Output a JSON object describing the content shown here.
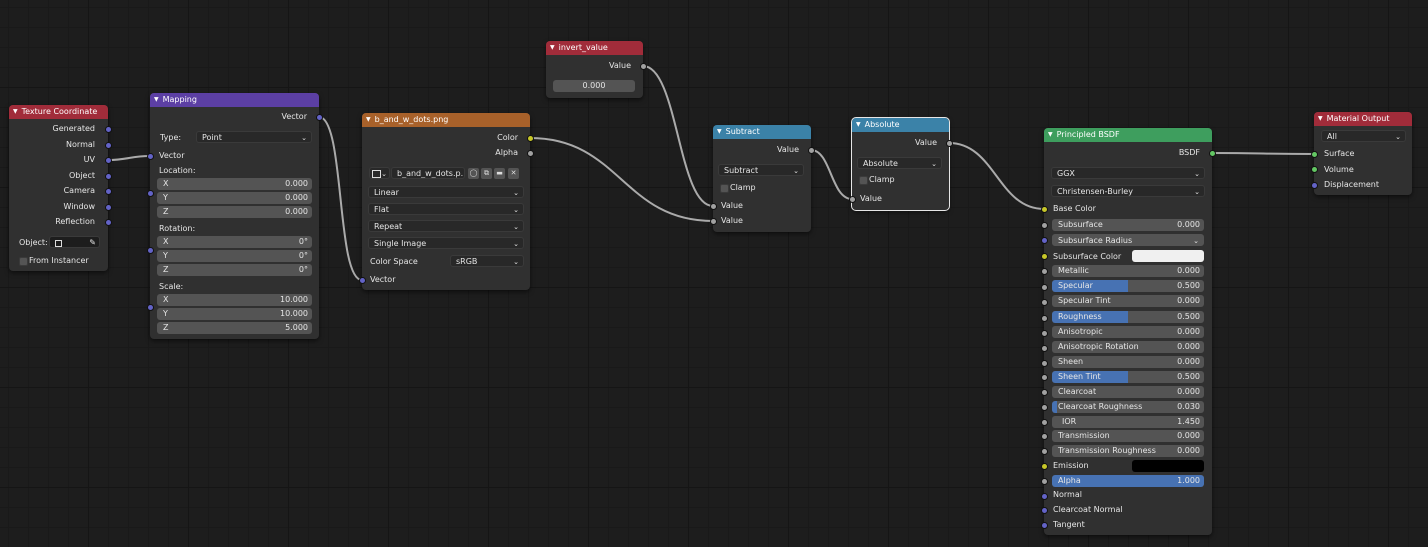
{
  "colors": {
    "bg": "#1d1d1d",
    "node": "#303030",
    "hdr_input": "#a12c3a",
    "hdr_vector": "#5c3fa4",
    "hdr_texture": "#a8612a",
    "hdr_converter": "#3b82a8",
    "hdr_shader": "#3e9e5e",
    "socket_vector": "#6363c7",
    "socket_value": "#a1a1a1",
    "socket_color": "#c7c729",
    "socket_shader": "#63c763",
    "slider_fill": "#4772b3"
  },
  "tex_coord": {
    "title": "Texture Coordinate",
    "outputs": [
      "Generated",
      "Normal",
      "UV",
      "Object",
      "Camera",
      "Window",
      "Reflection"
    ],
    "object_label": "Object:",
    "from_instancer": "From Instancer",
    "icons": {
      "object": "object-icon",
      "eyedropper": "eyedropper-icon"
    }
  },
  "mapping": {
    "title": "Mapping",
    "output": "Vector",
    "type_label": "Type:",
    "type_value": "Point",
    "vector_in": "Vector",
    "location_label": "Location:",
    "location": [
      {
        "axis": "X",
        "value": "0.000"
      },
      {
        "axis": "Y",
        "value": "0.000"
      },
      {
        "axis": "Z",
        "value": "0.000"
      }
    ],
    "rotation_label": "Rotation:",
    "rotation": [
      {
        "axis": "X",
        "value": "0°"
      },
      {
        "axis": "Y",
        "value": "0°"
      },
      {
        "axis": "Z",
        "value": "0°"
      }
    ],
    "scale_label": "Scale:",
    "scale": [
      {
        "axis": "X",
        "value": "10.000"
      },
      {
        "axis": "Y",
        "value": "10.000"
      },
      {
        "axis": "Z",
        "value": "5.000"
      }
    ]
  },
  "image_tex": {
    "title": "b_and_w_dots.png",
    "out_color": "Color",
    "out_alpha": "Alpha",
    "image_name": "b_and_w_dots.p...",
    "interpolation": "Linear",
    "projection": "Flat",
    "extension": "Repeat",
    "source": "Single Image",
    "colorspace_label": "Color Space",
    "colorspace_value": "sRGB",
    "vector_in": "Vector",
    "icons": {
      "image": "image-icon",
      "fake_user": "shield-icon",
      "duplicate": "duplicate-icon",
      "open": "folder-icon",
      "unlink": "close-icon"
    }
  },
  "invert": {
    "title": "invert_value",
    "output": "Value",
    "value": "0.000"
  },
  "subtract": {
    "title": "Subtract",
    "output": "Value",
    "operation": "Subtract",
    "clamp": "Clamp",
    "in1": "Value",
    "in2": "Value"
  },
  "absolute": {
    "title": "Absolute",
    "output": "Value",
    "operation": "Absolute",
    "clamp": "Clamp",
    "in1": "Value"
  },
  "bsdf": {
    "title": "Principled BSDF",
    "output": "BSDF",
    "distribution": "GGX",
    "subsurface_method": "Christensen-Burley",
    "base_color": "Base Color",
    "subsurface": {
      "label": "Subsurface",
      "value": "0.000",
      "fill": 0
    },
    "subsurface_radius": "Subsurface Radius",
    "subsurface_color": "Subsurface Color",
    "metallic": {
      "label": "Metallic",
      "value": "0.000",
      "fill": 0
    },
    "specular": {
      "label": "Specular",
      "value": "0.500",
      "fill": 0.5
    },
    "specular_tint": {
      "label": "Specular Tint",
      "value": "0.000",
      "fill": 0
    },
    "roughness": {
      "label": "Roughness",
      "value": "0.500",
      "fill": 0.5
    },
    "anisotropic": {
      "label": "Anisotropic",
      "value": "0.000",
      "fill": 0
    },
    "anisotropic_rotation": {
      "label": "Anisotropic Rotation",
      "value": "0.000",
      "fill": 0
    },
    "sheen": {
      "label": "Sheen",
      "value": "0.000",
      "fill": 0
    },
    "sheen_tint": {
      "label": "Sheen Tint",
      "value": "0.500",
      "fill": 0.5
    },
    "clearcoat": {
      "label": "Clearcoat",
      "value": "0.000",
      "fill": 0
    },
    "clearcoat_roughness": {
      "label": "Clearcoat Roughness",
      "value": "0.030",
      "fill": 0.03
    },
    "ior": {
      "label": "IOR",
      "value": "1.450"
    },
    "transmission": {
      "label": "Transmission",
      "value": "0.000",
      "fill": 0
    },
    "transmission_roughness": {
      "label": "Transmission Roughness",
      "value": "0.000",
      "fill": 0
    },
    "emission": "Emission",
    "alpha": {
      "label": "Alpha",
      "value": "1.000",
      "fill": 1
    },
    "normal": "Normal",
    "clearcoat_normal": "Clearcoat Normal",
    "tangent": "Tangent",
    "subsurface_color_swatch": "#f0f0f0",
    "emission_swatch": "#000000"
  },
  "output": {
    "title": "Material Output",
    "target": "All",
    "surface": "Surface",
    "volume": "Volume",
    "displacement": "Displacement"
  }
}
